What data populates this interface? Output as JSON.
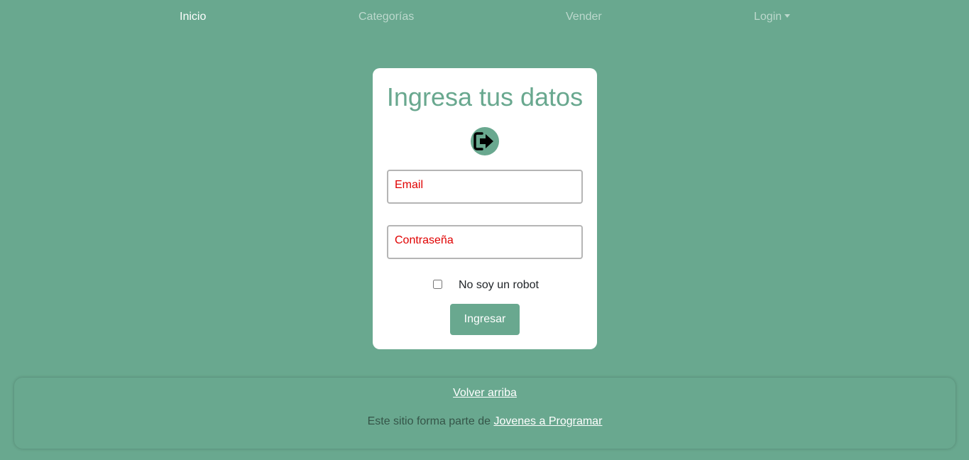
{
  "nav": {
    "items": [
      {
        "label": "Inicio",
        "active": true
      },
      {
        "label": "Categorías",
        "active": false
      },
      {
        "label": "Vender",
        "active": false
      },
      {
        "label": "Login",
        "active": false,
        "dropdown": true
      }
    ]
  },
  "login_card": {
    "title": "Ingresa tus datos",
    "icon": "sign-out-arrow-icon",
    "email_placeholder": "Email",
    "password_placeholder": "Contraseña",
    "robot_label": "No soy un robot",
    "robot_checked": false,
    "submit_label": "Ingresar"
  },
  "footer": {
    "back_to_top_label": "Volver arriba",
    "credit_text": "Este sitio forma parte de ",
    "credit_link": "Jovenes a Programar"
  },
  "colors": {
    "background": "#69a88f",
    "placeholder_red": "#e00000",
    "card": "#ffffff"
  }
}
